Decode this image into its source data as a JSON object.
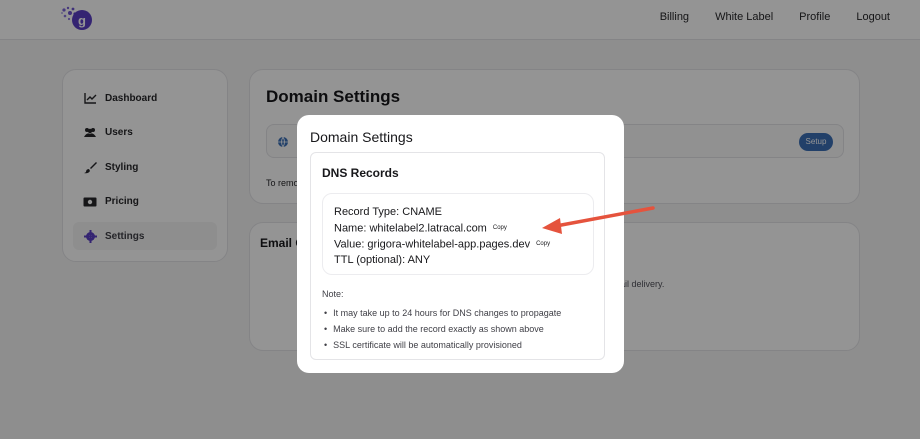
{
  "nav": {
    "items": [
      "Billing",
      "White Label",
      "Profile",
      "Logout"
    ]
  },
  "sidebar": {
    "items": [
      {
        "label": "Dashboard",
        "icon": "chart-line-icon"
      },
      {
        "label": "Users",
        "icon": "users-icon"
      },
      {
        "label": "Styling",
        "icon": "paintbrush-icon"
      },
      {
        "label": "Pricing",
        "icon": "money-icon"
      },
      {
        "label": "Settings",
        "icon": "gear-icon",
        "active": true
      }
    ]
  },
  "domain_card": {
    "title": "Domain Settings",
    "setup_label": "Setup",
    "remove_text": "To remo"
  },
  "email_card": {
    "title": "Email C",
    "text": "ail delivery."
  },
  "modal": {
    "title": "Domain Settings",
    "dns_title": "DNS Records",
    "record_type": "Record Type: CNAME",
    "name": "Name: whitelabel2.latracal.com",
    "value": "Value: grigora-whitelabel-app.pages.dev",
    "ttl": "TTL (optional): ANY",
    "copy_label": "Copy",
    "note_label": "Note:",
    "notes": [
      "It may take up to 24 hours for DNS changes to propagate",
      "Make sure to add the record exactly as shown above",
      "SSL certificate will be automatically provisioned"
    ]
  },
  "colors": {
    "accent": "#6d5bd0",
    "annotation_arrow": "#e5533d",
    "setup_button": "#3b6fb6"
  }
}
